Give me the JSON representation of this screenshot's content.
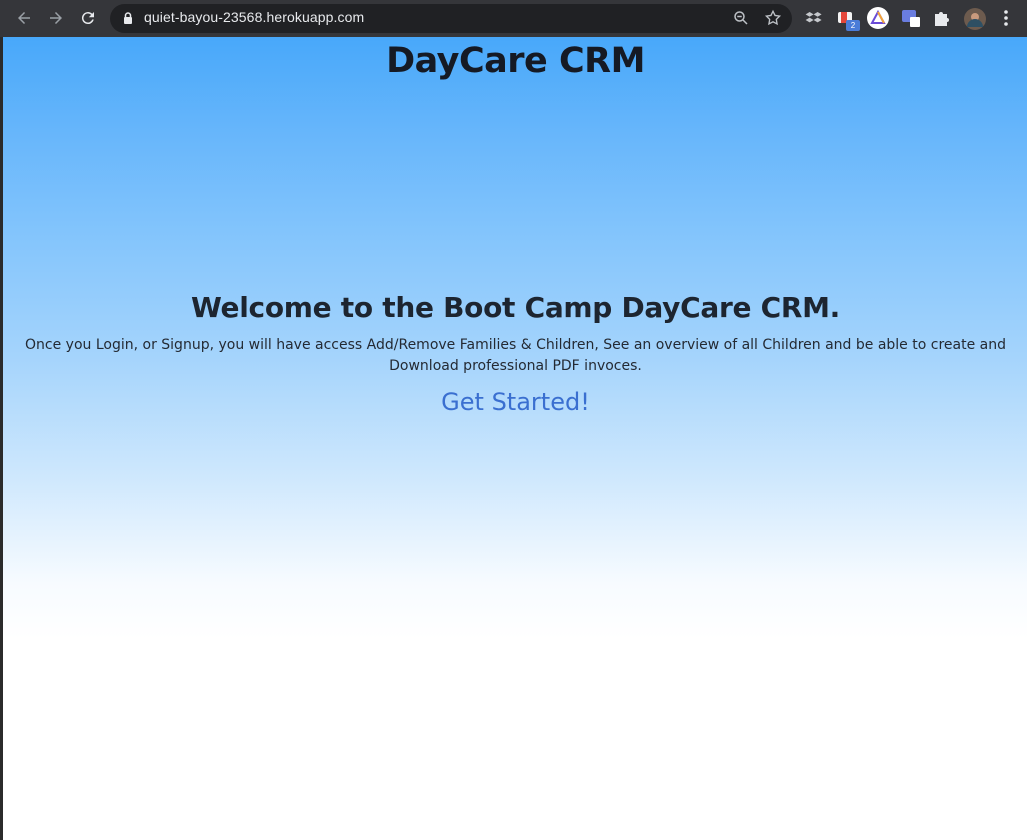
{
  "browser": {
    "url": "quiet-bayou-23568.herokuapp.com",
    "extension_badge": "2"
  },
  "page": {
    "title": "DayCare CRM",
    "welcome": "Welcome to the Boot Camp DayCare CRM.",
    "description": "Once you Login, or Signup, you will have access Add/Remove Families & Children, See an overview of all Children and be able to create and Download professional PDF invoces.",
    "cta_label": "Get Started!"
  },
  "colors": {
    "gradient_top": "#48a8fa",
    "cta": "#3a6fd0"
  }
}
